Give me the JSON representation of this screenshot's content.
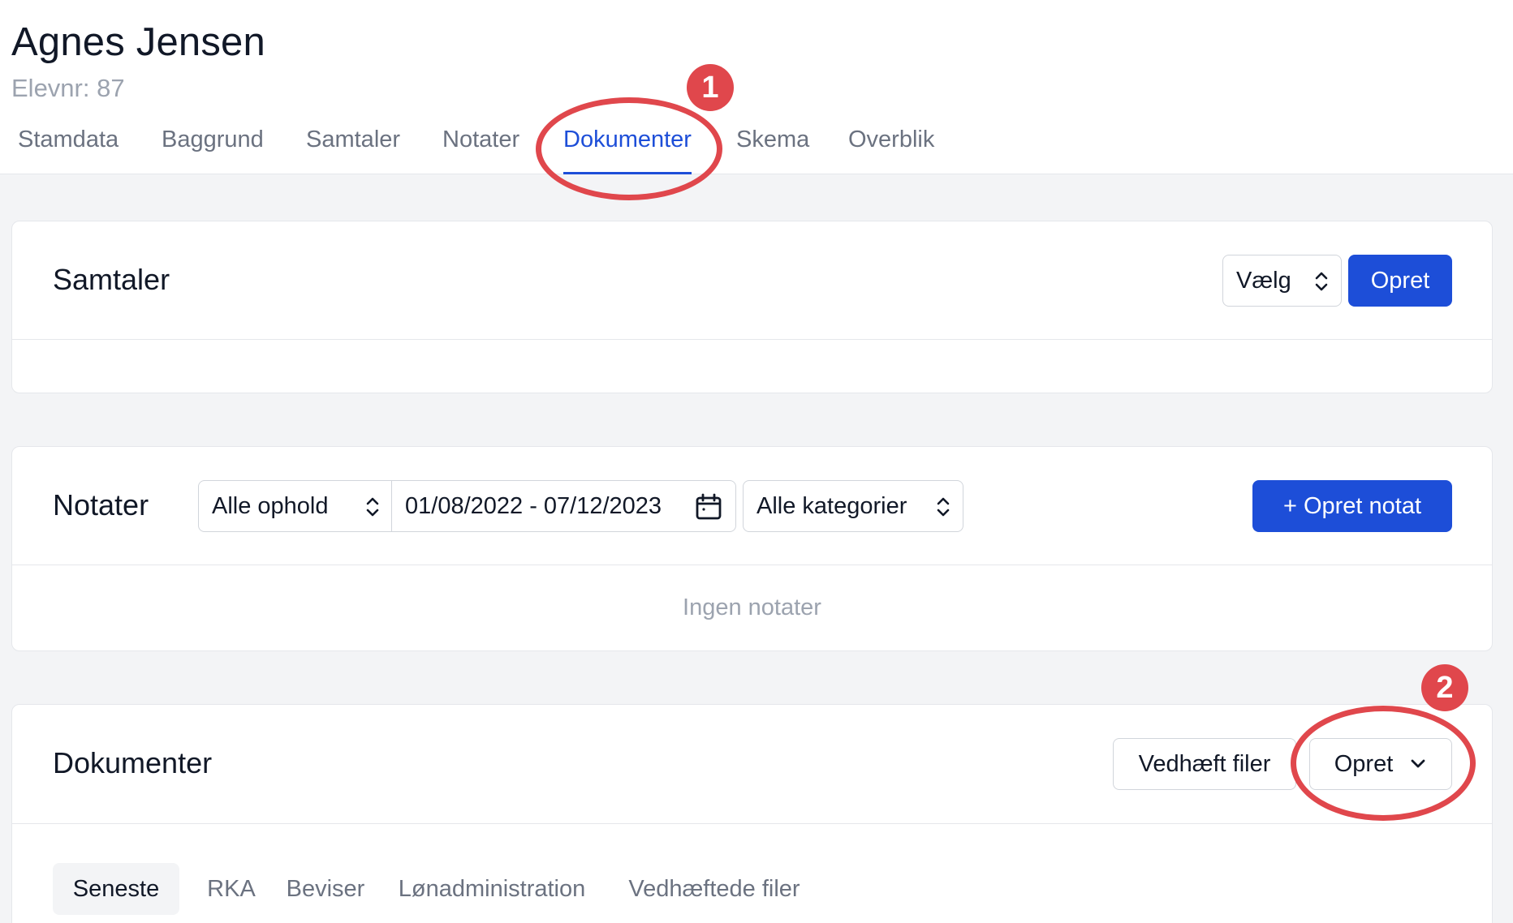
{
  "student": {
    "name": "Agnes Jensen",
    "student_number": "Elevnr: 87"
  },
  "nav": {
    "tabs": [
      {
        "label": "Stamdata"
      },
      {
        "label": "Baggrund"
      },
      {
        "label": "Samtaler"
      },
      {
        "label": "Notater"
      },
      {
        "label": "Dokumenter",
        "active": true
      },
      {
        "label": "Skema"
      },
      {
        "label": "Overblik"
      }
    ]
  },
  "samtaler": {
    "title": "Samtaler",
    "select_value": "Vælg",
    "create_label": "Opret"
  },
  "notater": {
    "title": "Notater",
    "stay_filter": "Alle ophold",
    "date_range": "01/08/2022 - 07/12/2023",
    "category_filter": "Alle kategorier",
    "create_label": "+ Opret notat",
    "empty_text": "Ingen notater"
  },
  "dokumenter": {
    "title": "Dokumenter",
    "attach_label": "Vedhæft filer",
    "create_label": "Opret",
    "tabs": [
      {
        "label": "Seneste",
        "active": true
      },
      {
        "label": "RKA"
      },
      {
        "label": "Beviser"
      },
      {
        "label": "Lønadministration"
      },
      {
        "label": "Vedhæftede filer"
      }
    ]
  },
  "annotations": [
    {
      "label": "1"
    },
    {
      "label": "2"
    }
  ],
  "colors": {
    "primary": "#1d4ed8",
    "annotation": "#e0474c",
    "muted_text": "#9ca3af",
    "page_bg": "#f3f4f6"
  },
  "icons": [
    "chevron-up-down-icon",
    "calendar-icon",
    "plus-icon",
    "chevron-down-icon"
  ]
}
